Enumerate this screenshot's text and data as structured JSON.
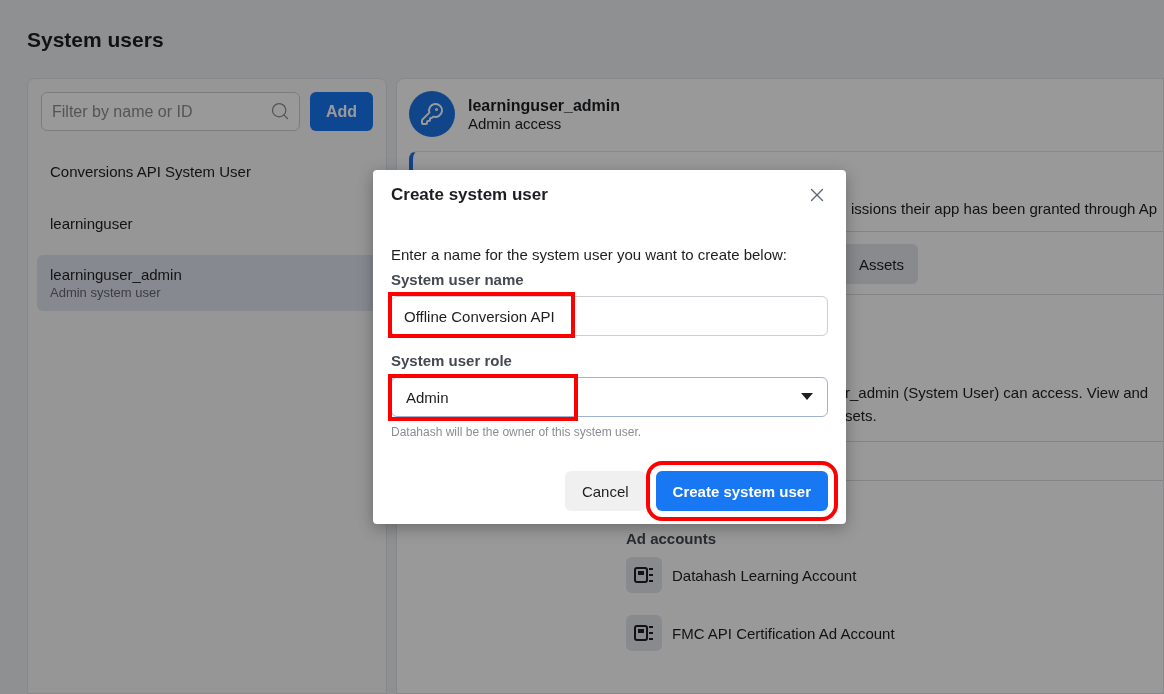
{
  "page_title": "System users",
  "sidebar": {
    "search": {
      "placeholder": "Filter by name or ID"
    },
    "add_button": "Add",
    "items": [
      {
        "name": "Conversions API System User",
        "selected": false
      },
      {
        "name": "learninguser",
        "selected": false
      },
      {
        "name": "learninguser_admin",
        "subtitle": "Admin system user",
        "selected": true
      }
    ]
  },
  "detail": {
    "name": "learninguser_admin",
    "access": "Admin access",
    "notice_text": "issions their app has been granted through Ap",
    "assets_button": "Assets",
    "assets_description": "r_admin (System User) can access. View and",
    "assets_description_2": "sets.",
    "section_title": "Ad accounts",
    "ad_accounts": [
      "Datahash Learning Account",
      "FMC API Certification Ad Account"
    ]
  },
  "dialog": {
    "title": "Create system user",
    "intro": "Enter a name for the system user you want to create below:",
    "name_field": {
      "label": "System user name",
      "value": "Offline Conversion API",
      "highlighted": true
    },
    "role_field": {
      "label": "System user role",
      "value": "Admin",
      "highlighted": true
    },
    "helper": "Datahash will be the owner of this system user.",
    "buttons": [
      {
        "label": "Cancel",
        "kind": "secondary",
        "highlighted": false
      },
      {
        "label": "Create system user",
        "kind": "primary",
        "highlighted": true
      }
    ]
  }
}
